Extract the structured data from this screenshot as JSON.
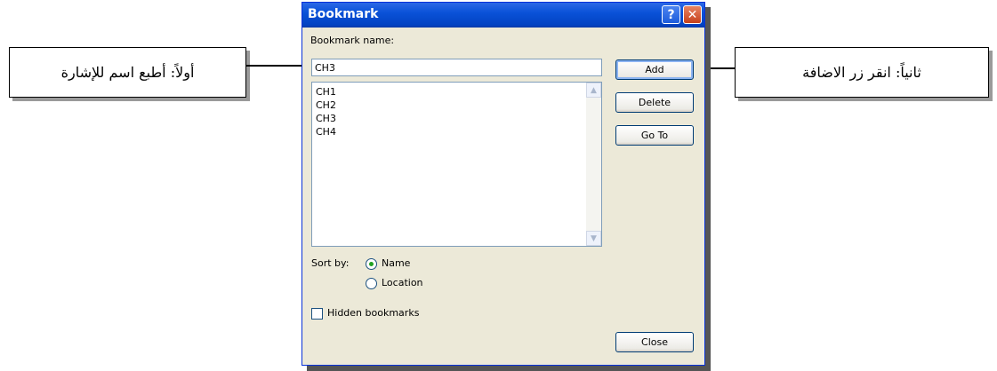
{
  "callouts": {
    "left": "أولاً: أطبع اسم للإشارة",
    "right": "ثانياً: انقر زر الاضافة"
  },
  "dialog": {
    "title": "Bookmark",
    "help_icon": "?",
    "close_icon": "✕",
    "bookmark_name_label": "Bookmark name:",
    "bookmark_name_value": "CH3",
    "list_items": [
      "CH1",
      "CH2",
      "CH3",
      "CH4"
    ],
    "buttons": {
      "add": "Add",
      "delete": "Delete",
      "goto": "Go To",
      "close": "Close"
    },
    "sort_by_label": "Sort by:",
    "sort_options": [
      "Name",
      "Location"
    ],
    "sort_selected": "Name",
    "hidden_bookmarks_label": "Hidden bookmarks",
    "hidden_bookmarks_checked": false
  },
  "colors": {
    "titlebar": "#0a52d8",
    "dialog_bg": "#ece9d8",
    "radio_dot": "#21a121"
  }
}
